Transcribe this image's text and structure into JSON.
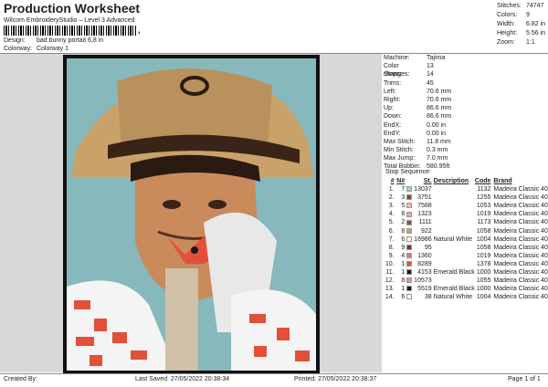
{
  "header": {
    "title": "Production Worksheet",
    "subtitle": "Wilcom EmbroideryStudio – Level 3 Advanced",
    "barcode_suffix": ",",
    "design_label": "Design:",
    "design_value": "bad bunny portait 6,8 in",
    "colorway_label": "Colorway:",
    "colorway_value": "Colorway 1"
  },
  "stats": [
    {
      "label": "Stitches:",
      "value": "74747"
    },
    {
      "label": "Colors:",
      "value": "9"
    },
    {
      "label": "Width:",
      "value": "6.82 in"
    },
    {
      "label": "Height:",
      "value": "5.56 in"
    },
    {
      "label": "Zoom:",
      "value": "1:1"
    }
  ],
  "machine": [
    {
      "label": "Machine:",
      "value": "Tajima"
    },
    {
      "label": "Color changes:",
      "value": "13"
    },
    {
      "label": "Stops:",
      "value": "14"
    },
    {
      "label": "Trims:",
      "value": "45"
    },
    {
      "label": "Left:",
      "value": "70.6 mm"
    },
    {
      "label": "Right:",
      "value": "70.6 mm"
    },
    {
      "label": "Up:",
      "value": "86.6 mm"
    },
    {
      "label": "Down:",
      "value": "86.6 mm"
    },
    {
      "label": "EndX:",
      "value": "0.00 in"
    },
    {
      "label": "EndY:",
      "value": "0.00 in"
    },
    {
      "label": "Max Stitch:",
      "value": "11.8 mm"
    },
    {
      "label": "Min Stitch:",
      "value": "0.3 mm"
    },
    {
      "label": "Max Jump:",
      "value": "7.0 mm"
    },
    {
      "label": "Total Bobbin:",
      "value": "580.95ft"
    }
  ],
  "sequence": {
    "heading": "Stop Sequence:",
    "columns": [
      "#",
      "N#",
      "St.",
      "Description",
      "Code",
      "Brand"
    ],
    "rows": [
      {
        "num": "1.",
        "n": "7",
        "color": "#9ccfe0",
        "st": "13037",
        "desc": "",
        "code": "1132",
        "brand": "Madeira Classic 40"
      },
      {
        "num": "2.",
        "n": "3",
        "color": "#7a4a2e",
        "st": "3751",
        "desc": "",
        "code": "1255",
        "brand": "Madeira Classic 40"
      },
      {
        "num": "3.",
        "n": "5",
        "color": "#f2b89c",
        "st": "7588",
        "desc": "",
        "code": "1053",
        "brand": "Madeira Classic 40"
      },
      {
        "num": "4.",
        "n": "8",
        "color": "#e8a8a0",
        "st": "1323",
        "desc": "",
        "code": "1019",
        "brand": "Madeira Classic 40"
      },
      {
        "num": "5.",
        "n": "2",
        "color": "#8a5a2c",
        "st": "1111",
        "desc": "",
        "code": "1173",
        "brand": "Madeira Classic 40"
      },
      {
        "num": "6.",
        "n": "8",
        "color": "#c9a070",
        "st": "922",
        "desc": "",
        "code": "1058",
        "brand": "Madeira Classic 40"
      },
      {
        "num": "7.",
        "n": "6",
        "color": "#f4f4f4",
        "st": "16986",
        "desc": "Natural White",
        "code": "1004",
        "brand": "Madeira Classic 40"
      },
      {
        "num": "8.",
        "n": "9",
        "color": "#7a3028",
        "st": "95",
        "desc": "",
        "code": "1058",
        "brand": "Madeira Classic 40"
      },
      {
        "num": "9.",
        "n": "4",
        "color": "#d08070",
        "st": "1360",
        "desc": "",
        "code": "1019",
        "brand": "Madeira Classic 40"
      },
      {
        "num": "10.",
        "n": "1",
        "color": "#e2503a",
        "st": "8289",
        "desc": "",
        "code": "1378",
        "brand": "Madeira Classic 40"
      },
      {
        "num": "11.",
        "n": "1",
        "color": "#1a1a1a",
        "st": "4153",
        "desc": "Emerald Black",
        "code": "1000",
        "brand": "Madeira Classic 40"
      },
      {
        "num": "12.",
        "n": "8",
        "color": "#d49a86",
        "st": "10573",
        "desc": "",
        "code": "1055",
        "brand": "Madeira Classic 40"
      },
      {
        "num": "13.",
        "n": "1",
        "color": "#1a1a1a",
        "st": "5519",
        "desc": "Emerald Black",
        "code": "1000",
        "brand": "Madeira Classic 40"
      },
      {
        "num": "14.",
        "n": "6",
        "color": "#f4f4f4",
        "st": "38",
        "desc": "Natural White",
        "code": "1004",
        "brand": "Madeira Classic 40"
      }
    ]
  },
  "footer": {
    "created_by": "Created By:",
    "last_saved": "Last Saved: 27/05/2022 20:38:34",
    "printed": "Printed: 27/05/2022 20:38:37",
    "page": "Page 1 of 1"
  }
}
